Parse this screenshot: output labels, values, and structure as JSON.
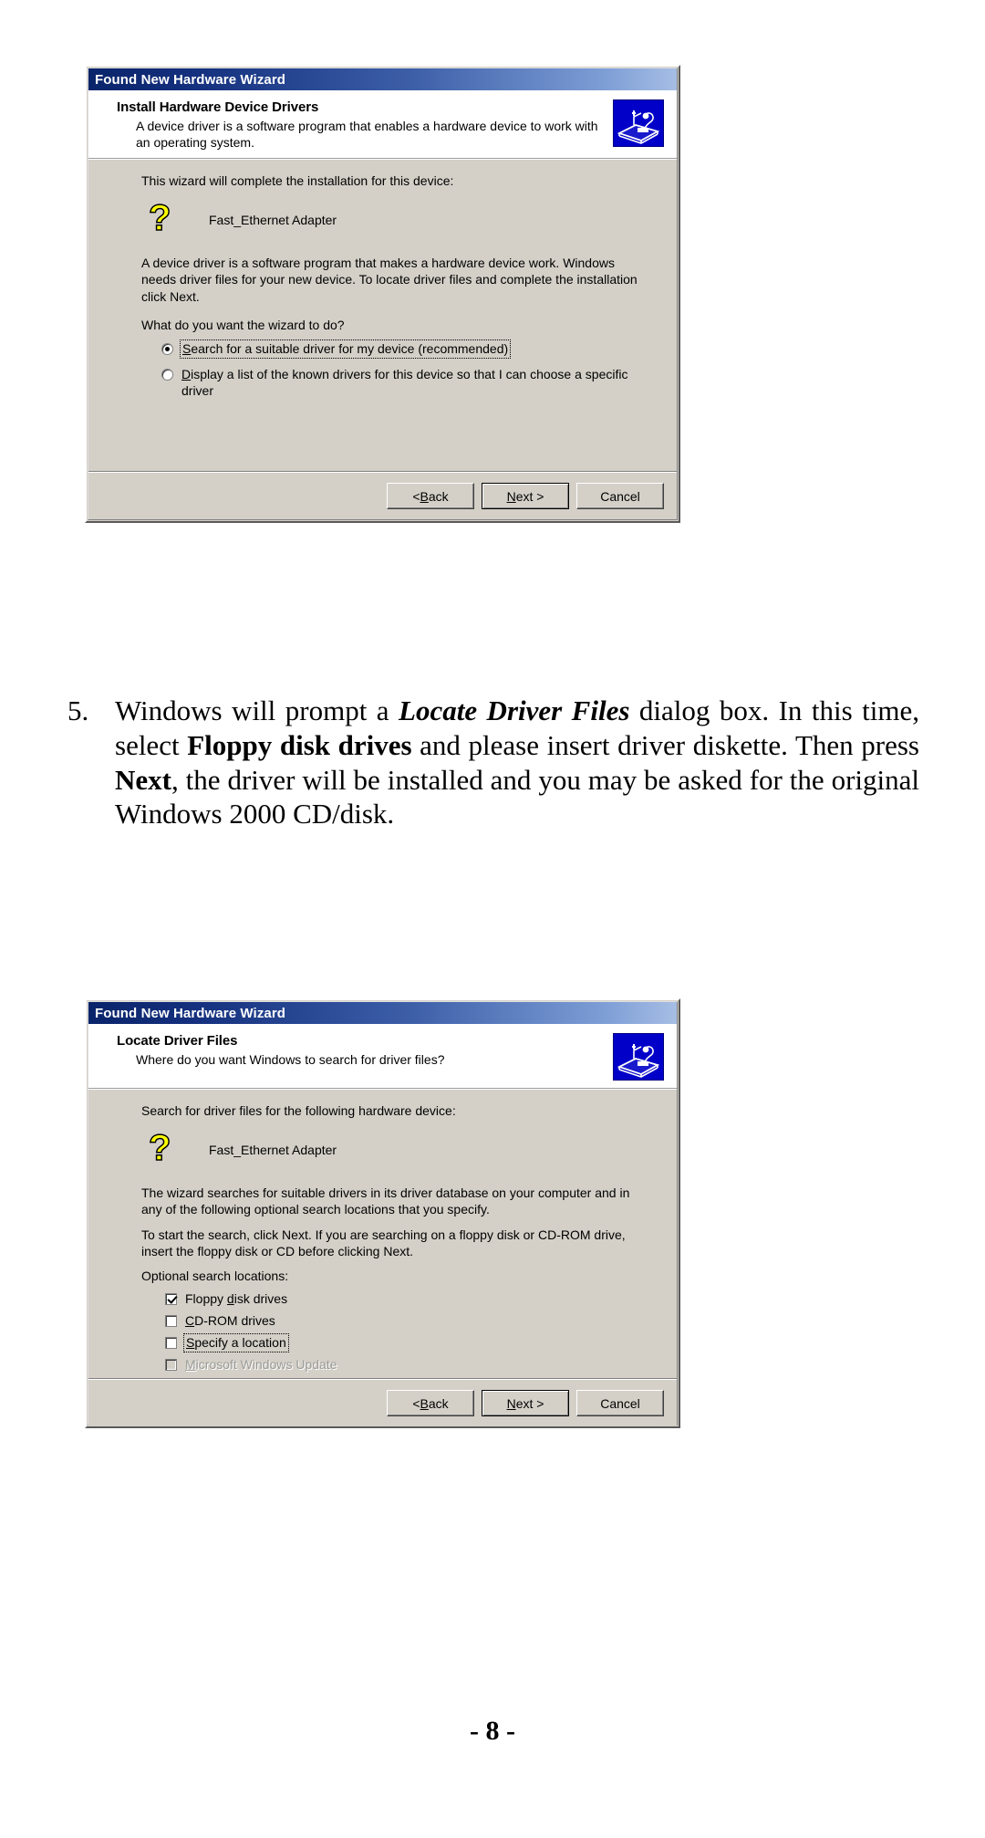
{
  "page": {
    "number_label": "- 8 -"
  },
  "dialog1": {
    "titlebar": "Found New Hardware Wizard",
    "header_title": "Install Hardware Device Drivers",
    "header_sub": "A device driver is a software program that enables a hardware device to work with an operating system.",
    "icon_name": "hardware-install-icon",
    "intro": "This wizard will complete the installation for this device:",
    "device_name": "Fast_Ethernet Adapter",
    "device_icon_glyph": "?",
    "description": "A device driver is a software program that makes a hardware device work. Windows needs driver files for your new device. To locate driver files and complete the installation click Next.",
    "question": "What do you want the wizard to do?",
    "options": [
      {
        "label_before": "",
        "accel": "S",
        "label_after": "earch for a suitable driver for my device (recommended)",
        "selected": true,
        "focused": true
      },
      {
        "label_before": "",
        "accel": "D",
        "label_after": "isplay a list of the known drivers for this device so that I can choose a specific driver",
        "selected": false,
        "focused": false
      }
    ],
    "buttons": {
      "back_prefix": "< ",
      "back_accel": "B",
      "back_suffix": "ack",
      "next_accel": "N",
      "next_suffix": "ext >",
      "cancel": "Cancel"
    }
  },
  "step": {
    "number": "5.",
    "parts": [
      {
        "text": "Windows will prompt a ",
        "style": "normal"
      },
      {
        "text": "Locate Driver Files",
        "style": "bold-italic"
      },
      {
        "text": " dialog box. In this time, select ",
        "style": "normal"
      },
      {
        "text": "Floppy disk drives",
        "style": "bold"
      },
      {
        "text": " and please  insert driver diskette. Then press ",
        "style": "normal"
      },
      {
        "text": "Next",
        "style": "bold"
      },
      {
        "text": ", the driver will be installed and you may be asked for the original Windows 2000 CD/disk.",
        "style": "normal"
      }
    ]
  },
  "dialog2": {
    "titlebar": "Found New Hardware Wizard",
    "header_title": "Locate Driver Files",
    "header_sub": "Where do you want Windows to search for driver files?",
    "icon_name": "hardware-install-icon",
    "intro": "Search for driver files for the following hardware device:",
    "device_name": "Fast_Ethernet Adapter",
    "device_icon_glyph": "?",
    "description1": "The wizard searches for suitable drivers in its driver database on your computer and in any of the following optional search locations that you specify.",
    "description2": "To start the search, click Next. If you are searching on a floppy disk or CD-ROM drive, insert the floppy disk or CD before clicking Next.",
    "locations_label": "Optional search locations:",
    "checkboxes": [
      {
        "label_before": "Floppy ",
        "accel": "d",
        "label_after": "isk drives",
        "checked": true,
        "disabled": false,
        "focused": false
      },
      {
        "label_before": "",
        "accel": "C",
        "label_after": "D-ROM drives",
        "checked": false,
        "disabled": false,
        "focused": false
      },
      {
        "label_before": "",
        "accel": "S",
        "label_after": "pecify a location",
        "checked": false,
        "disabled": false,
        "focused": true
      },
      {
        "label_before": "",
        "accel": "M",
        "label_after": "icrosoft Windows Update",
        "checked": false,
        "disabled": true,
        "focused": false
      }
    ],
    "buttons": {
      "back_prefix": "< ",
      "back_accel": "B",
      "back_suffix": "ack",
      "next_accel": "N",
      "next_suffix": "ext >",
      "cancel": "Cancel"
    }
  },
  "colors": {
    "dialog_face": "#d4d0c8",
    "titlebar_start": "#0a246a",
    "titlebar_end": "#a6bee4",
    "icon_blue": "#0000c8",
    "device_yellow": "#ffff00",
    "disabled_text": "#9a9a96"
  }
}
